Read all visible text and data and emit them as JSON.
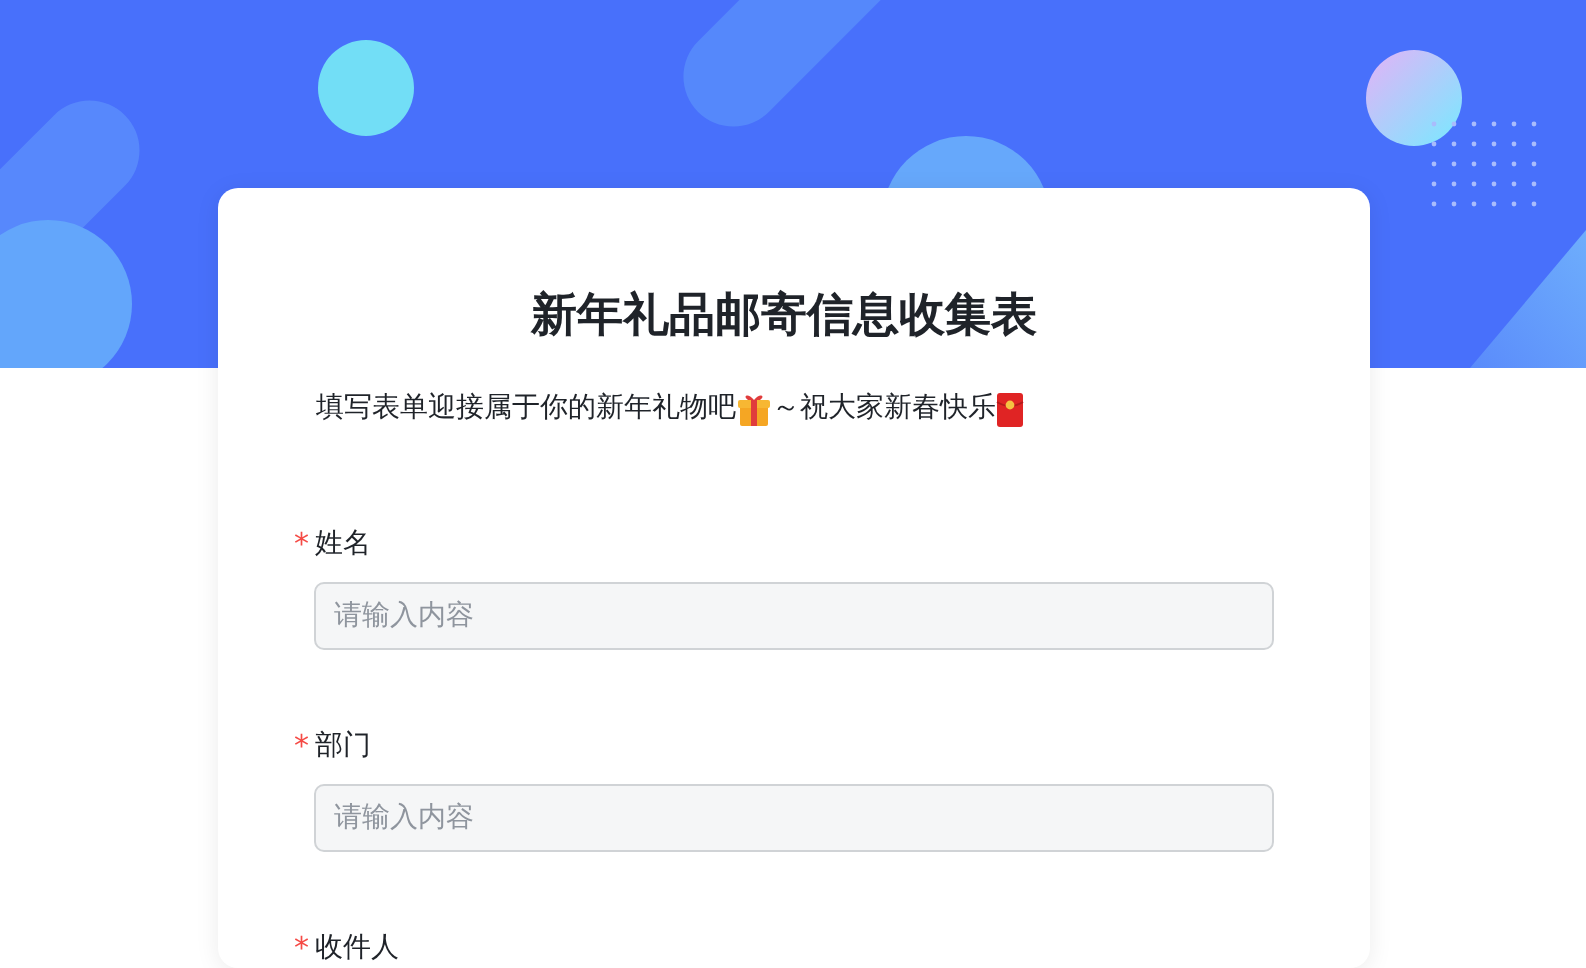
{
  "form": {
    "title": "新年礼品邮寄信息收集表",
    "intro": [
      {
        "kind": "text",
        "text": "填写表单迎接属于你的新年礼物吧"
      },
      {
        "kind": "gift"
      },
      {
        "kind": "text",
        "text": "～祝大家新春快乐"
      },
      {
        "kind": "envelope"
      }
    ],
    "fields": [
      {
        "label": "姓名",
        "required_mark": "*",
        "placeholder": "请输入内容"
      },
      {
        "label": "部门",
        "required_mark": "*",
        "placeholder": "请输入内容"
      },
      {
        "label": "收件人",
        "required_mark": "*"
      }
    ]
  }
}
